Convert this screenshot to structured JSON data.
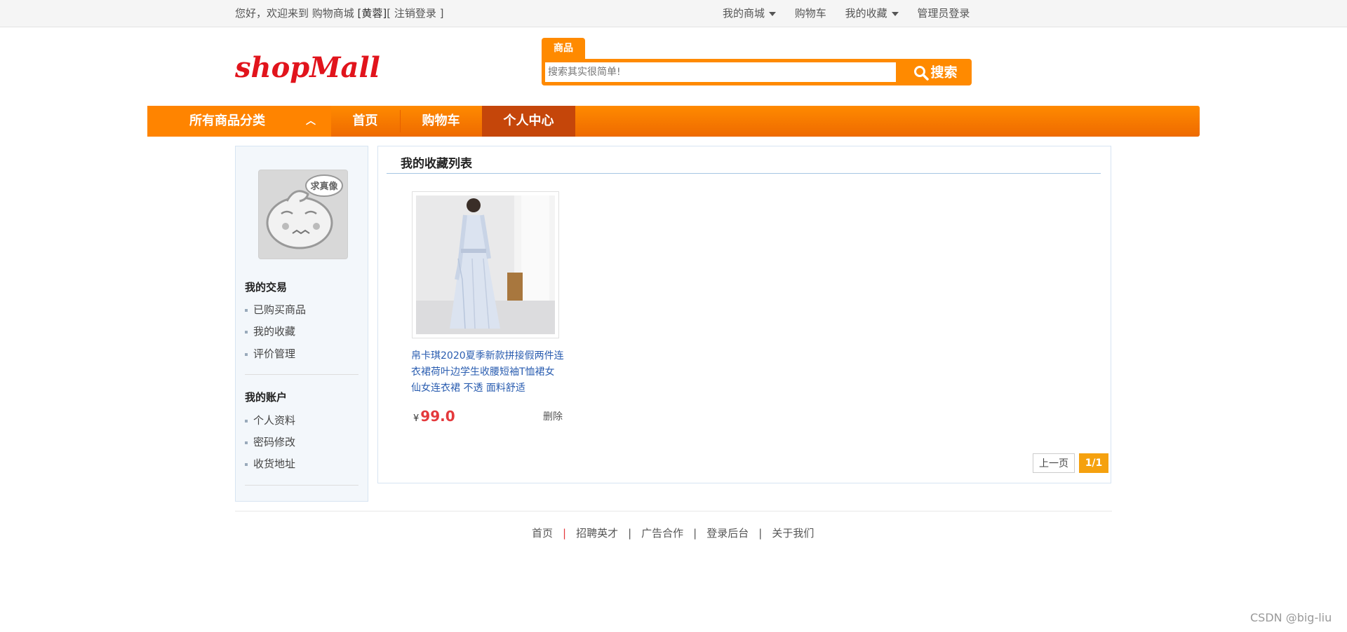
{
  "topbar": {
    "welcome": "您好，欢迎来到 购物商城 ",
    "username": "[黄蓉]",
    "logout": "[ 注销登录 ]",
    "links": [
      "我的商城",
      "购物车",
      "我的收藏",
      "管理员登录"
    ]
  },
  "header": {
    "logo_text": "shopMall",
    "search_tab": "商品",
    "search_placeholder": "搜索其实很简单!",
    "search_button": "搜索"
  },
  "nav": {
    "category": "所有商品分类",
    "items": [
      "首页",
      "购物车",
      "个人中心"
    ],
    "active": "个人中心"
  },
  "sidebar": {
    "avatar_tag": "求真像",
    "section1_title": "我的交易",
    "section1_items": [
      "已购买商品",
      "我的收藏",
      "评价管理"
    ],
    "section2_title": "我的账户",
    "section2_items": [
      "个人资料",
      "密码修改",
      "收货地址"
    ]
  },
  "main": {
    "title": "我的收藏列表",
    "product": {
      "name": "帛卡琪2020夏季新款拼接假两件连衣裙荷叶边学生收腰短袖T恤裙女 仙女连衣裙 不透 面料舒适",
      "currency": "¥",
      "price": "99.0",
      "delete_label": "删除"
    },
    "pager": {
      "prev": "上一页",
      "current": "1/1"
    }
  },
  "footer": {
    "links": [
      "首页",
      "招聘英才",
      "广告合作",
      "登录后台",
      "关于我们"
    ]
  },
  "watermark": "CSDN @big-liu",
  "colors": {
    "accent": "#ff8a00",
    "nav_active": "#c5460a",
    "price": "#e4393c",
    "link": "#2a5db0"
  }
}
